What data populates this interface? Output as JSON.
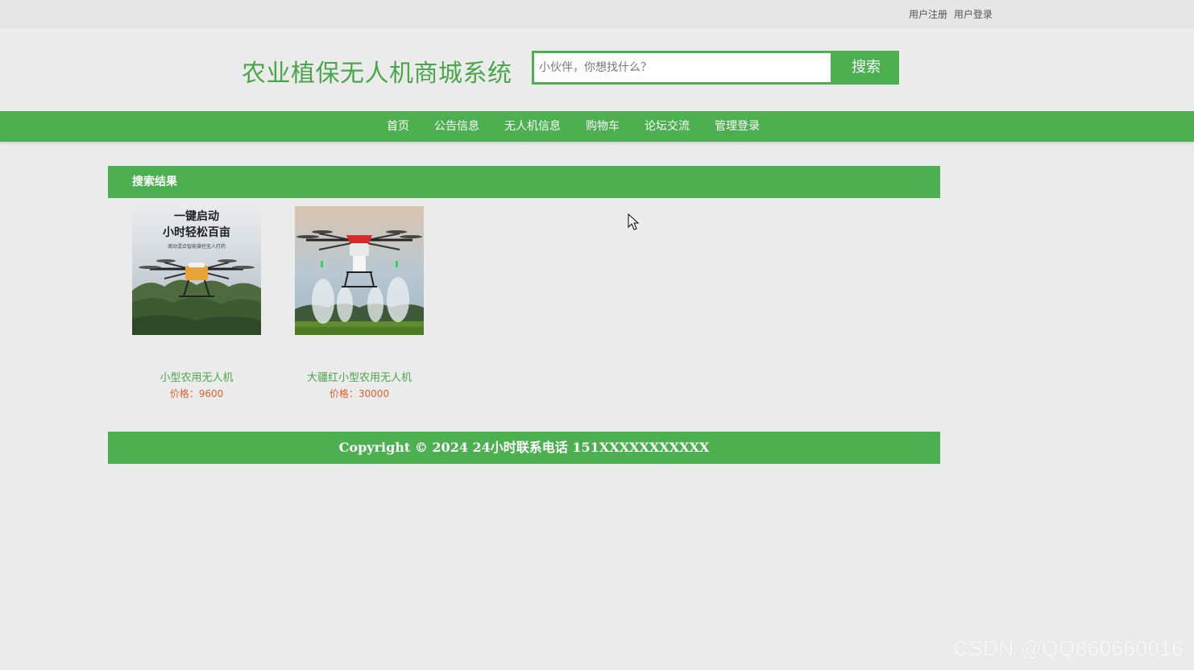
{
  "topbar": {
    "register": "用户注册",
    "login": "用户登录"
  },
  "header": {
    "title": "农业植保无人机商城系统",
    "search_placeholder": "小伙伴，你想找什么？",
    "search_button": "搜索"
  },
  "nav": {
    "items": [
      "首页",
      "公告信息",
      "无人机信息",
      "购物车",
      "论坛交流",
      "管理登录"
    ]
  },
  "results": {
    "heading": "搜索结果",
    "products": [
      {
        "name": "小型农用无人机",
        "price": "价格：9600",
        "poster_line1": "一键启动",
        "poster_line2": "小时轻松百亩",
        "poster_line3": "滴动混合智能操控无人打药"
      },
      {
        "name": "大疆红小型农用无人机",
        "price": "价格：30000"
      }
    ]
  },
  "footer": {
    "text": "Copyright © 2024 24小时联系电话 151XXXXXXXXXXX"
  },
  "watermark": "CSDN @QQ860660016",
  "colors": {
    "brand_green": "#4caf50",
    "title_green": "#4aa64a",
    "price_orange": "#e0602c",
    "background": "#ebebeb"
  }
}
